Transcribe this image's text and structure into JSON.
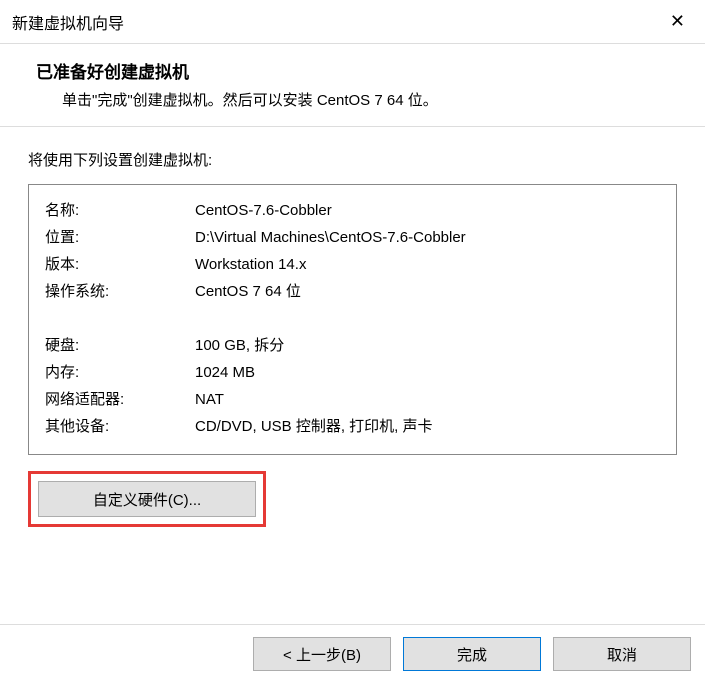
{
  "window": {
    "title": "新建虚拟机向导",
    "close": "✕"
  },
  "header": {
    "heading": "已准备好创建虚拟机",
    "subheading": "单击\"完成\"创建虚拟机。然后可以安装 CentOS 7 64 位。"
  },
  "settings_caption": "将使用下列设置创建虚拟机:",
  "summary": {
    "name_label": "名称:",
    "name_value": "CentOS-7.6-Cobbler",
    "location_label": "位置:",
    "location_value": "D:\\Virtual Machines\\CentOS-7.6-Cobbler",
    "version_label": "版本:",
    "version_value": "Workstation 14.x",
    "os_label": "操作系统:",
    "os_value": "CentOS 7 64 位",
    "disk_label": "硬盘:",
    "disk_value": "100 GB, 拆分",
    "memory_label": "内存:",
    "memory_value": "1024 MB",
    "network_label": "网络适配器:",
    "network_value": "NAT",
    "other_label": "其他设备:",
    "other_value": "CD/DVD, USB 控制器, 打印机, 声卡"
  },
  "buttons": {
    "customize_hw": "自定义硬件(C)...",
    "back": "< 上一步(B)",
    "finish": "完成",
    "cancel": "取消"
  }
}
